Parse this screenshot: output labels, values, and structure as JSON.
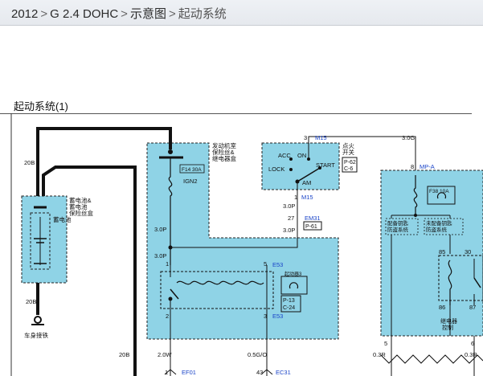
{
  "breadcrumb": {
    "year": "2012",
    "engine": "G 2.4 DOHC",
    "section": "示意图",
    "current": "起动系统",
    "sep": ">"
  },
  "diagram": {
    "title": "起动系统(1)",
    "labels": {
      "wire_20b_top": "20B",
      "wire_20b_bottom": "20B",
      "wire_20b_right": "20B",
      "battery_box": "蓄电池&\n蓄电池\n保险丝盒",
      "battery": "蓄电池",
      "ground": "车身接铁",
      "relay_box_title": "发动机室\n保险丝&\n继电器盒",
      "fuse_f14": "F14 30A",
      "ign2": "IGN2",
      "w30p_1": "3.0P",
      "w30p_2": "3.0P",
      "pin1_left": "1",
      "pin5": "5",
      "e53_top": "E53",
      "starter_relay": "起动器3",
      "p13": "P-13",
      "c24": "C-24",
      "pin2": "2",
      "pin3": "3",
      "e53_bottom": "E53",
      "w20w": "2.0W",
      "w05go": "0.5G/O",
      "ef01": "EF01",
      "ec31": "EC31",
      "pin1_bot": "1",
      "pin43": "43",
      "pin3_top": "3",
      "m15_top": "M15",
      "ign_switch": "点火\n开关",
      "acc": "ACC",
      "on": "ON",
      "lock": "LOCK",
      "start": "START",
      "am": "AM",
      "p62": "P-62",
      "c6": "C-6",
      "pin1_m15": "1",
      "m15_bot": "M15",
      "w30p_3": "3.0P",
      "pin27": "27",
      "em31": "EM31",
      "w30p_4": "3.0P",
      "p61": "P-61",
      "w30g": "3.0G",
      "pin8": "8",
      "mpa": "MP-A",
      "fuse_f38": "F38 10A",
      "alarm1": "配备钥匙\n防盗系统",
      "alarm2": "未配备钥匙\n防盗系统",
      "pin85": "85",
      "pin30": "30",
      "pin86": "86",
      "pin87": "87",
      "relay_ctrl": "继电器\n控制",
      "pin5_bot": "5",
      "pin6_bot": "6",
      "w03r_1": "0.3R",
      "w03r_2": "0.3R"
    }
  }
}
